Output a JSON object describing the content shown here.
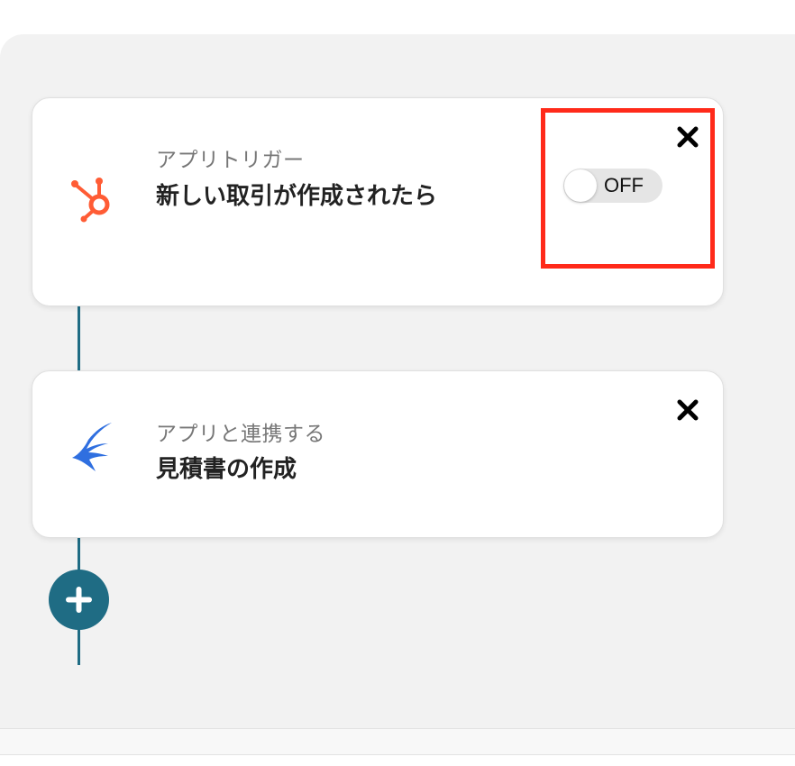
{
  "trigger_card": {
    "label": "アプリトリガー",
    "title": "新しい取引が作成されたら",
    "toggle_state": "OFF",
    "app_icon": "hubspot-icon",
    "close_icon": "close-icon"
  },
  "action_card": {
    "label": "アプリと連携する",
    "title": "見積書の作成",
    "app_icon": "swallow-bird-icon",
    "close_icon": "close-icon"
  },
  "add_step": {
    "icon": "plus-icon"
  },
  "colors": {
    "canvas_bg": "#f2f2f2",
    "accent": "#1f6c84",
    "hubspot_orange": "#ff5c35",
    "highlight_red": "#ff2a1a",
    "bird_blue": "#2f6fe0"
  }
}
